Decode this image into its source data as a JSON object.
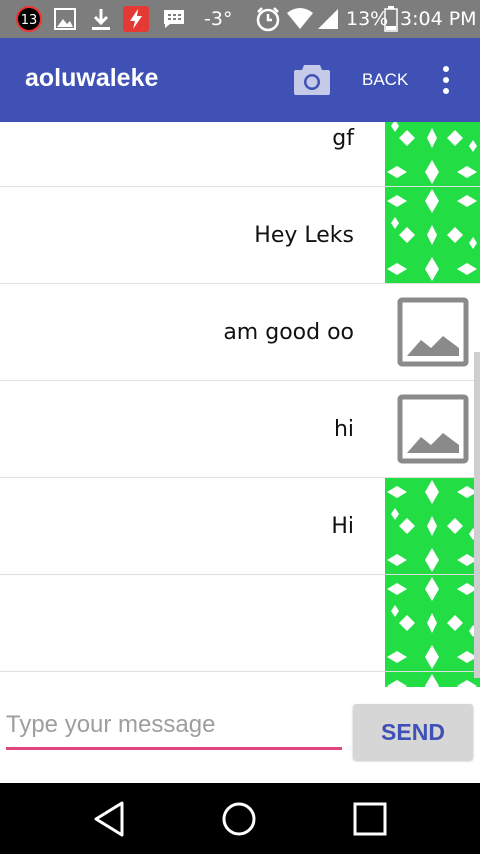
{
  "status_bar": {
    "notification_count": "13",
    "signal_label": "-3°",
    "battery_percent": "13%",
    "time": "3:04 PM"
  },
  "app_bar": {
    "title": "aoluwaleke",
    "back_label": "BACK"
  },
  "messages": [
    {
      "text": "gf",
      "avatar": "green-pattern"
    },
    {
      "text": "Hey Leks",
      "avatar": "green-pattern"
    },
    {
      "text": "am good oo",
      "avatar": "image-placeholder"
    },
    {
      "text": "hi",
      "avatar": "image-placeholder"
    },
    {
      "text": "Hi",
      "avatar": "green-pattern"
    },
    {
      "text": "",
      "avatar": "green-pattern"
    },
    {
      "text": "",
      "avatar": "green-pattern"
    }
  ],
  "composer": {
    "placeholder": "Type your message",
    "send_label": "SEND"
  },
  "colors": {
    "app_bar": "#3f51b5",
    "status_bar": "#7d7d7d",
    "avatar_green": "#22dd44",
    "input_underline": "#e0457e",
    "send_text": "#3f51b5"
  }
}
